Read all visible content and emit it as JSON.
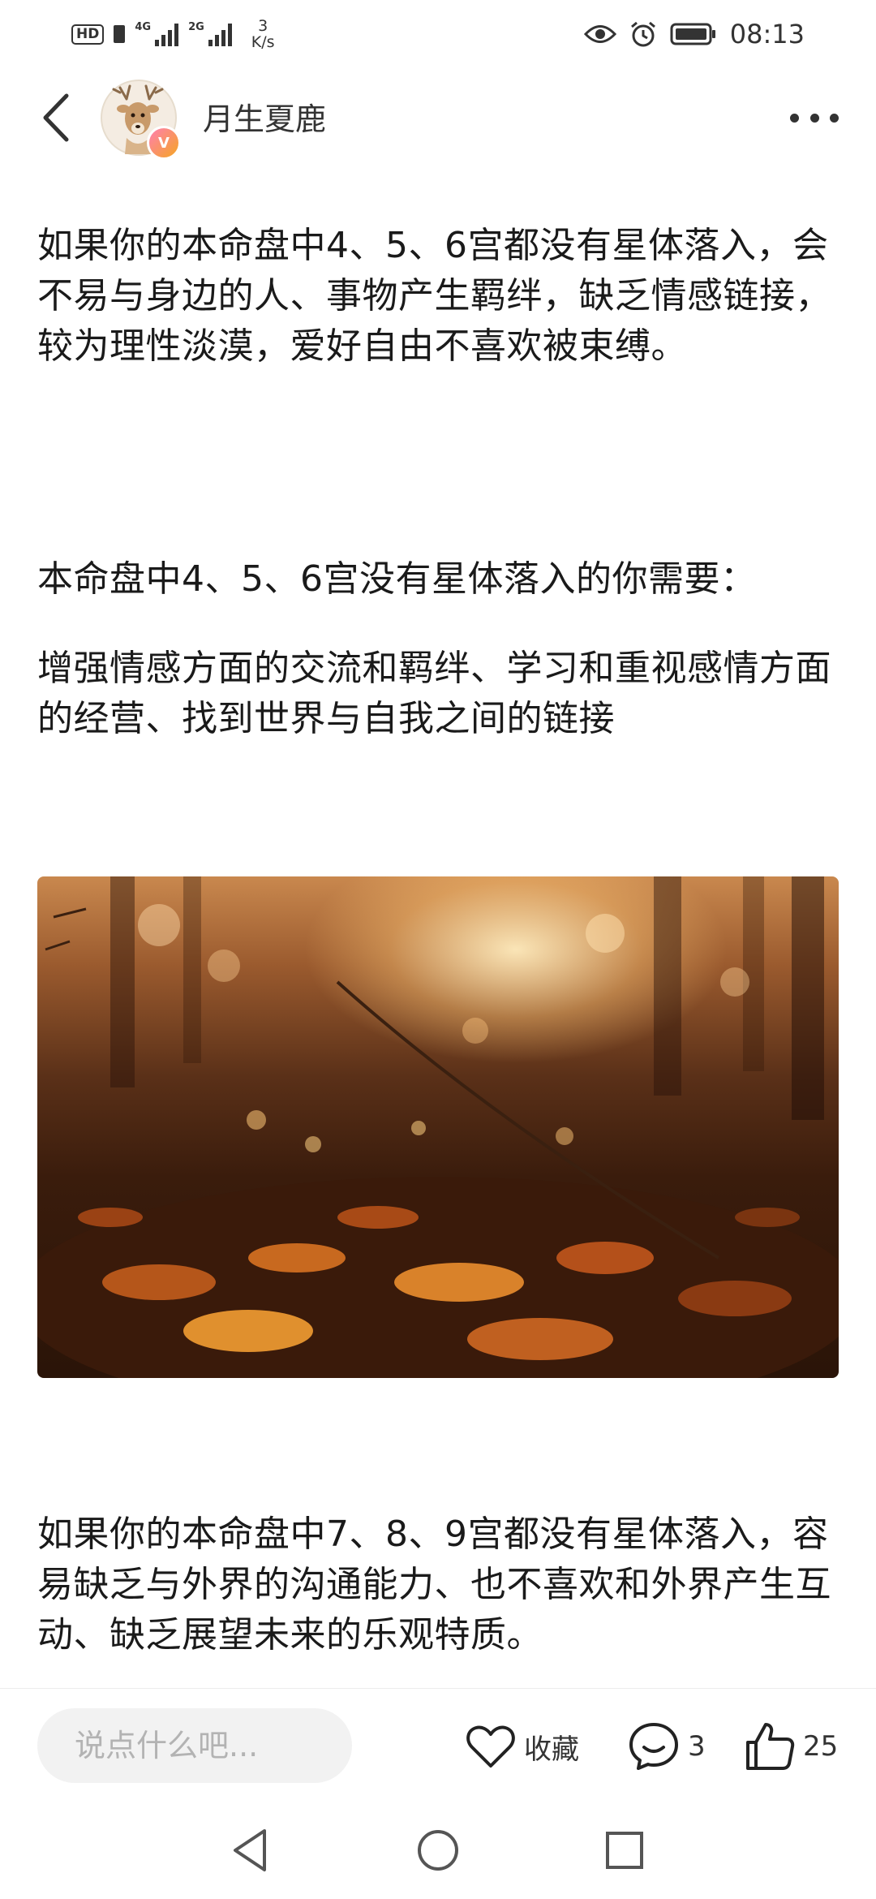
{
  "status_bar": {
    "hd": "HD",
    "sim1": "4G",
    "sim2": "2G",
    "speed_value": "3",
    "speed_unit": "K/s",
    "time": "08:13"
  },
  "header": {
    "author": "月生夏鹿",
    "badge": "V"
  },
  "article": {
    "para1": "如果你的本命盘中4、5、6宫都没有星体落入，会不易与身边的人、事物产生羁绊，缺乏情感链接，较为理性淡漠，爱好自由不喜欢被束缚。",
    "para2": "本命盘中4、5、6宫没有星体落入的你需要：",
    "para3": "增强情感方面的交流和羁绊、学习和重视感情方面的经营、找到世界与自我之间的链接",
    "para4": "如果你的本命盘中7、8、9宫都没有星体落入，容易缺乏与外界的沟通能力、也不喜欢和外界产生互动、缺乏展望未来的乐观特质。"
  },
  "action_bar": {
    "comment_placeholder": "说点什么吧...",
    "favorite_label": "收藏",
    "comment_count": "3",
    "like_count": "25"
  },
  "icons": {
    "back": "chevron-left-icon",
    "more": "more-dots-icon",
    "favorite": "heart-outline-icon",
    "comment": "speech-bubble-smile-icon",
    "like": "thumbs-up-icon"
  },
  "colors": {
    "text": "#1a1a1a",
    "muted": "#333333",
    "input_bg": "#f2f2f2"
  }
}
